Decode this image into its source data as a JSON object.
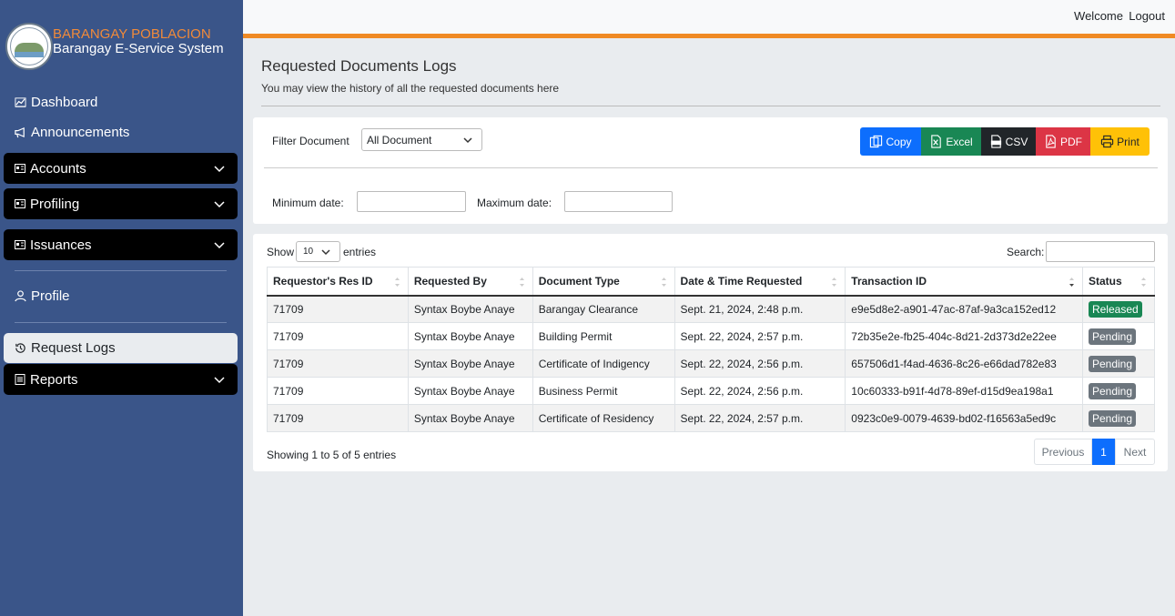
{
  "brand": {
    "title": "BARANGAY POBLACION",
    "subtitle": "Barangay E-Service System"
  },
  "colors": {
    "sidebar": "#3a5589",
    "accent": "#f08a24",
    "active": "#0d6efd"
  },
  "sidebar": {
    "dashboard": "Dashboard",
    "announcements": "Announcements",
    "accounts": "Accounts",
    "profiling": "Profiling",
    "issuances": "Issuances",
    "profile": "Profile",
    "request_logs": "Request Logs",
    "reports": "Reports"
  },
  "topbar": {
    "welcome": "Welcome",
    "logout": "Logout"
  },
  "page": {
    "title": "Requested Documents Logs",
    "subtitle": "You may view the history of all the requested documents here"
  },
  "filter": {
    "label": "Filter Document",
    "selected": "All Document",
    "min_label": "Minimum date:",
    "max_label": "Maximum date:"
  },
  "export_buttons": {
    "copy": "Copy",
    "excel": "Excel",
    "csv": "CSV",
    "pdf": "PDF",
    "print": "Print"
  },
  "table_controls": {
    "show": "Show",
    "length": "10",
    "entries": "entries",
    "search": "Search:"
  },
  "table": {
    "headers": [
      "Requestor's Res ID",
      "Requested By",
      "Document Type",
      "Date & Time Requested",
      "Transaction ID",
      "Status"
    ],
    "rows": [
      [
        "71709",
        "Syntax Boybe Anaye",
        "Barangay Clearance",
        "Sept. 21, 2024, 2:48 p.m.",
        "e9e5d8e2-a901-47ac-87af-9a3ca152ed12",
        "Released"
      ],
      [
        "71709",
        "Syntax Boybe Anaye",
        "Building Permit",
        "Sept. 22, 2024, 2:57 p.m.",
        "72b35e2e-fb25-404c-8d21-2d373d2e22ee",
        "Pending"
      ],
      [
        "71709",
        "Syntax Boybe Anaye",
        "Certificate of Indigency",
        "Sept. 22, 2024, 2:56 p.m.",
        "657506d1-f4ad-4636-8c26-e66dad782e83",
        "Pending"
      ],
      [
        "71709",
        "Syntax Boybe Anaye",
        "Business Permit",
        "Sept. 22, 2024, 2:56 p.m.",
        "10c60333-b91f-4d78-89ef-d15d9ea198a1",
        "Pending"
      ],
      [
        "71709",
        "Syntax Boybe Anaye",
        "Certificate of Residency",
        "Sept. 22, 2024, 2:57 p.m.",
        "0923c0e9-0079-4639-bd02-f16563a5ed9c",
        "Pending"
      ]
    ]
  },
  "footer": {
    "info": "Showing 1 to 5 of 5 entries",
    "previous": "Previous",
    "current_page": "1",
    "next": "Next"
  }
}
